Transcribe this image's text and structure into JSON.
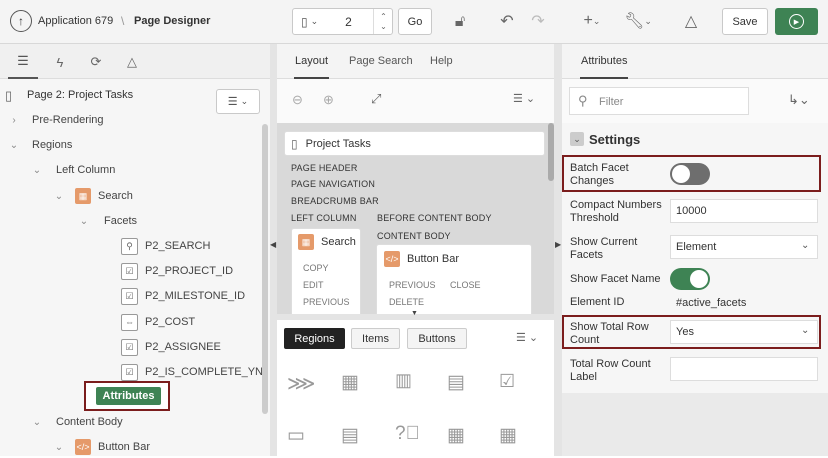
{
  "topbar": {
    "app_name": "Application 679",
    "separator": "\\",
    "page_designer": "Page Designer",
    "page_number": "2",
    "go_label": "Go",
    "save_label": "Save"
  },
  "left": {
    "page_title": "Page 2: Project Tasks",
    "tree": {
      "pre_rendering": "Pre-Rendering",
      "regions": "Regions",
      "left_column": "Left Column",
      "search": "Search",
      "facets": "Facets",
      "p2_search": "P2_SEARCH",
      "p2_project_id": "P2_PROJECT_ID",
      "p2_milestone_id": "P2_MILESTONE_ID",
      "p2_cost": "P2_COST",
      "p2_assignee": "P2_ASSIGNEE",
      "p2_is_complete": "P2_IS_COMPLETE_YN",
      "attributes": "Attributes",
      "content_body": "Content Body",
      "button_bar": "Button Bar"
    }
  },
  "middle": {
    "tabs": {
      "layout": "Layout",
      "page_search": "Page Search",
      "help": "Help"
    },
    "canvas": {
      "title": "Project Tasks",
      "page_header": "PAGE HEADER",
      "page_navigation": "PAGE NAVIGATION",
      "breadcrumb_bar": "BREADCRUMB BAR",
      "left_column": "LEFT COLUMN",
      "before_content_body": "BEFORE CONTENT BODY",
      "content_body": "CONTENT BODY",
      "search_card": "Search",
      "copy": "COPY",
      "edit": "EDIT",
      "previous": "PREVIOUS",
      "button_bar_card": "Button Bar",
      "bb_previous": "PREVIOUS",
      "bb_close": "CLOSE",
      "bb_delete": "DELETE"
    },
    "gallery_tabs": {
      "regions": "Regions",
      "items": "Items",
      "buttons": "Buttons"
    }
  },
  "right": {
    "tab": "Attributes",
    "filter_placeholder": "Filter",
    "section": "Settings",
    "props": {
      "batch_facet_changes": "Batch Facet Changes",
      "compact_numbers_threshold": "Compact Numbers Threshold",
      "compact_value": "10000",
      "show_current_facets": "Show Current Facets",
      "show_current_value": "Element",
      "show_facet_name": "Show Facet Name",
      "element_id": "Element ID",
      "element_id_value": "#active_facets",
      "show_total_row_count": "Show Total Row Count",
      "show_total_value": "Yes",
      "total_row_count_label": "Total Row Count Label"
    }
  },
  "colors": {
    "highlight": "#7b1d1d",
    "toggle_on": "#3e8354",
    "toggle_off": "#6e6e6e",
    "attributes_button": "#3e8354",
    "run_button": "#3e8354"
  }
}
